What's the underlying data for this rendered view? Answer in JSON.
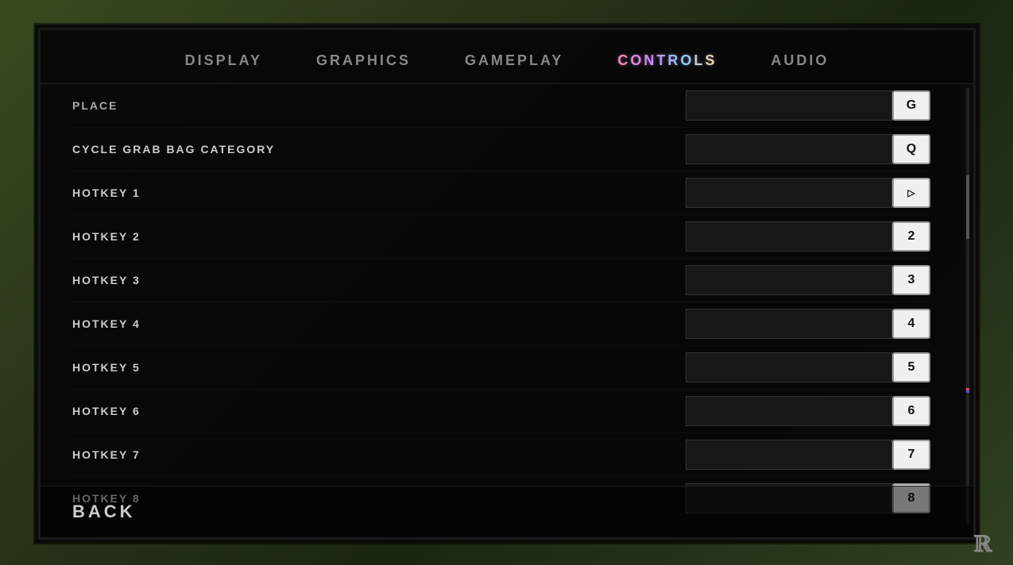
{
  "background": {
    "color": "#2a3a1a"
  },
  "tabs": [
    {
      "id": "display",
      "label": "DISPLAY",
      "active": false
    },
    {
      "id": "graphics",
      "label": "GRAPHICS",
      "active": false
    },
    {
      "id": "gameplay",
      "label": "GAMEPLAY",
      "active": false
    },
    {
      "id": "controls",
      "label": "CONTROLS",
      "active": true
    },
    {
      "id": "audio",
      "label": "AUDIO",
      "active": false
    }
  ],
  "settings": [
    {
      "name": "PLACE",
      "key": "G",
      "truncated": true
    },
    {
      "name": "CYCLE GRAB BAG CATEGORY",
      "key": "Q",
      "truncated": false
    },
    {
      "name": "HOTKEY 1",
      "key": "▷",
      "truncated": false,
      "icon": true
    },
    {
      "name": "HOTKEY 2",
      "key": "2",
      "truncated": false
    },
    {
      "name": "HOTKEY 3",
      "key": "3",
      "truncated": false
    },
    {
      "name": "HOTKEY 4",
      "key": "4",
      "truncated": false
    },
    {
      "name": "HOTKEY 5",
      "key": "5",
      "truncated": false
    },
    {
      "name": "HOTKEY 6",
      "key": "6",
      "truncated": false
    },
    {
      "name": "HOTKEY 7",
      "key": "7",
      "truncated": false
    },
    {
      "name": "HOTKEY 8",
      "key": "8",
      "truncated": false
    }
  ],
  "back_button": {
    "label": "BACK"
  },
  "logo": {
    "symbol": "⚔"
  }
}
